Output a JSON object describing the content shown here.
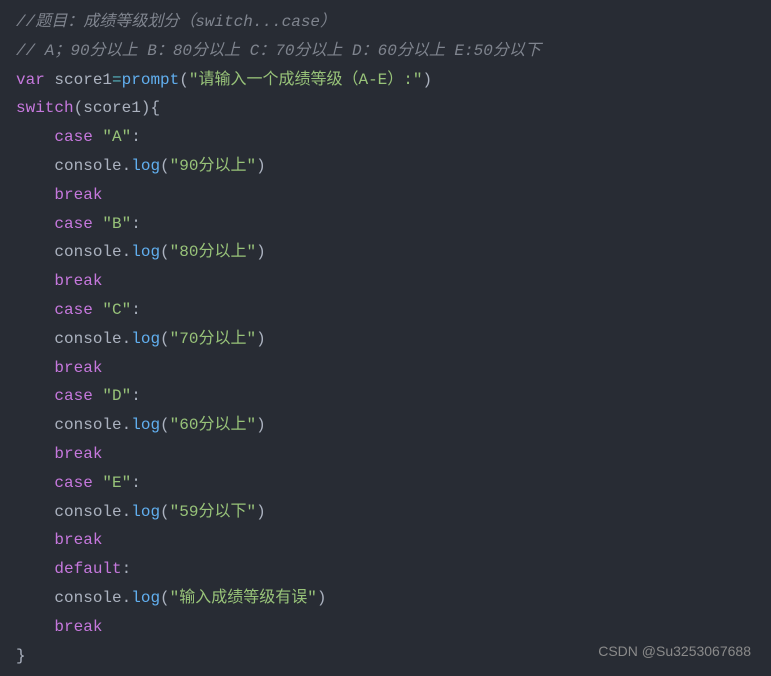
{
  "code": {
    "line1_comment": "//题目：成绩等级划分（switch...case）",
    "line2_comment": "// A；90分以上 B：80分以上 C：70分以上 D：60分以上 E:50分以下",
    "var_kw": "var",
    "score_var": " score1",
    "equals": "=",
    "prompt_fn": "prompt",
    "lparen": "(",
    "prompt_str": "\"请输入一个成绩等级（A-E）:\"",
    "rparen": ")",
    "switch_kw": "switch",
    "score_ref": "score1",
    "lbrace": "{",
    "rbrace": "}",
    "case_kw": "case",
    "console_obj": "    console",
    "dot": ".",
    "log_fn": "log",
    "break_kw": "break",
    "default_kw": "default",
    "colon": ":",
    "case_a": " \"A\"",
    "case_b": " \"B\"",
    "case_c": " \"C\"",
    "case_d": " \"D\"",
    "case_e": " \"E\"",
    "msg_a": "\"90分以上\"",
    "msg_b": "\"80分以上\"",
    "msg_c": "\"70分以上\"",
    "msg_d": "\"60分以上\"",
    "msg_e": "\"59分以下\"",
    "msg_default": "\"输入成绩等级有误\"",
    "indent1": "    ",
    "indent_case": "    ",
    "indent_body": "    "
  },
  "watermark": "CSDN @Su3253067688"
}
